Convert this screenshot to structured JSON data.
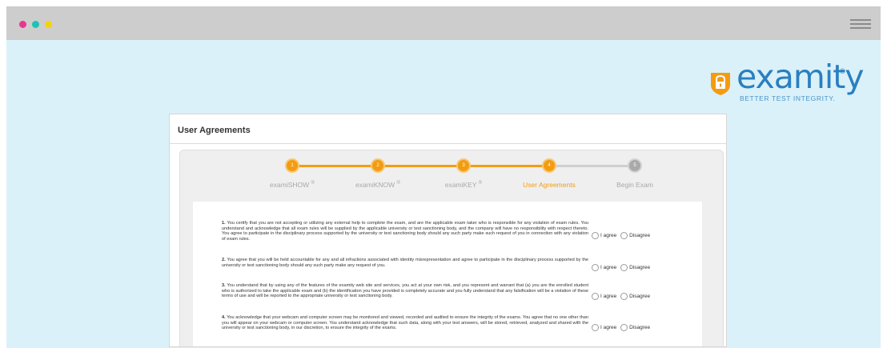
{
  "panel": {
    "title": "User Agreements"
  },
  "logo": {
    "name": "examity",
    "registered": "®",
    "tagline": "BETTER TEST INTEGRITY."
  },
  "steps": [
    {
      "number": "1",
      "label": "examiSHOW",
      "mark": "®",
      "state": "done"
    },
    {
      "number": "2",
      "label": "examiKNOW",
      "mark": "®",
      "state": "done"
    },
    {
      "number": "3",
      "label": "examiKEY",
      "mark": "®",
      "state": "done"
    },
    {
      "number": "4",
      "label": "User Agreements",
      "mark": "",
      "state": "active"
    },
    {
      "number": "5",
      "label": "Begin Exam",
      "mark": "",
      "state": "pending"
    }
  ],
  "clauses": [
    {
      "number": "1.",
      "text": "You certify that you are not accepting or utilizing any external help to complete the exam, and are the applicable exam taker who is responsible for any violation of exam rules. You understand and acknowledge that all exam rules will be supplied by the applicable university or test sanctioning body, and the company will have no responsibility with respect thereto. You agree to participate in the disciplinary process supported by the university or test sanctioning body should any such party make such request of you in connection with any violation of exam rules."
    },
    {
      "number": "2.",
      "text": "You agree that you will be held accountable for any and all infractions associated with identity misrepresentation and agree to participate in the disciplinary process supported by the university or test sanctioning body should any such party make any request of you."
    },
    {
      "number": "3.",
      "text": "You understand that by using any of the features of the examity web site and services, you act at your own risk, and you represent and warrant that (a) you are the enrolled student who is authorized to take the applicable exam and (b) the identification you have provided is completely accurate and you fully understand that any falsification will be a violation of these terms of use and will be reported to the appropriate university or test sanctioning body."
    },
    {
      "number": "4.",
      "text": "You acknowledge that your webcam and computer screen may be monitored and viewed, recorded and audited to ensure the integrity of the exams. You agree that no one other than you will appear on your webcam or computer screen. You understand acknowledge that such data, along with your test answers, will be stored, retrieved, analyzed and shared with the university or test sanctioning body, in our discretion, to ensure the integrity of the exams."
    }
  ],
  "choices": {
    "agree": "I agree",
    "disagree": "Disagree"
  },
  "colors": {
    "accent": "#f39c12",
    "brand": "#2a7fbf",
    "background": "#daf1f9"
  }
}
